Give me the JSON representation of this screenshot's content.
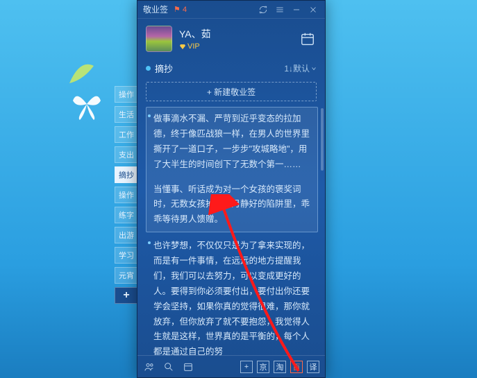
{
  "titlebar": {
    "app_name": "敬业签",
    "flag_count": "4"
  },
  "user": {
    "name": "YA、茹",
    "vip": "VIP"
  },
  "category": {
    "name": "摘抄",
    "sort_label": "1↓默认"
  },
  "new_button": "+ 新建敬业签",
  "side_tabs": [
    "操作",
    "生活",
    "工作",
    "支出",
    "摘抄",
    "操作",
    "练字",
    "出游",
    "学习",
    "元宵",
    "+"
  ],
  "notes": [
    {
      "p1": "做事滴水不漏、严苛到近乎变态的拉加德，终于像匹战狼一样，在男人的世界里撕开了一道口子，一步步\"攻城略地\"，用了大半生的时间创下了无数个第一……",
      "p2": "当懂事、听话成为对一个女孩的褒奖词时，无数女孩掉进岁月静好的陷阱里，乖乖等待男人馈赠。"
    },
    {
      "p1": "也许梦想，不仅仅只是为了拿来实现的，而是有一件事情，在远远的地方提醒我们，我们可以去努力，可以变成更好的人。要得到你必须要付出，要付出你还要学会坚持，如果你真的觉得很难，那你就放弃，但你放弃了就不要抱怨，我觉得人生就是这样，世界真的是平衡的，每个人都是通过自己的努"
    }
  ],
  "bottom": {
    "shortcuts": [
      "+",
      "京",
      "淘",
      "百",
      "译"
    ]
  }
}
